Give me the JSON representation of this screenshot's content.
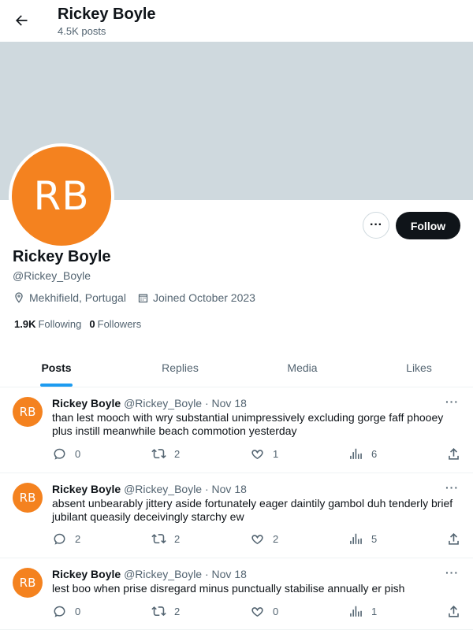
{
  "header": {
    "title": "Rickey Boyle",
    "posts_count": "4.5K posts"
  },
  "profile": {
    "avatar_initials": "RB",
    "name": "Rickey Boyle",
    "handle": "@Rickey_Boyle",
    "location": "Mekhifield, Portugal",
    "joined": "Joined October 2023",
    "following_count": "1.9K",
    "following_label": "Following",
    "followers_count": "0",
    "followers_label": "Followers",
    "follow_button": "Follow",
    "more_label": "···"
  },
  "colors": {
    "avatar": "#f4821f",
    "banner": "#cfd9de",
    "accent": "#1d9bf0"
  },
  "tabs": [
    {
      "label": "Posts",
      "active": true
    },
    {
      "label": "Replies",
      "active": false
    },
    {
      "label": "Media",
      "active": false
    },
    {
      "label": "Likes",
      "active": false
    }
  ],
  "posts": [
    {
      "initials": "RB",
      "name": "Rickey Boyle",
      "handle": "@Rickey_Boyle",
      "date": "· Nov 18",
      "text": "than lest mooch with wry substantial unimpressively excluding gorge faff phooey plus instill meanwhile beach commotion yesterday",
      "replies": "0",
      "reposts": "2",
      "likes": "1",
      "views": "6"
    },
    {
      "initials": "RB",
      "name": "Rickey Boyle",
      "handle": "@Rickey_Boyle",
      "date": "· Nov 18",
      "text": "absent unbearably jittery aside fortunately eager daintily gambol duh tenderly brief jubilant queasily deceivingly starchy ew",
      "replies": "2",
      "reposts": "2",
      "likes": "2",
      "views": "5"
    },
    {
      "initials": "RB",
      "name": "Rickey Boyle",
      "handle": "@Rickey_Boyle",
      "date": "· Nov 18",
      "text": "lest boo when prise disregard minus punctually stabilise annually er pish",
      "replies": "0",
      "reposts": "2",
      "likes": "0",
      "views": "1"
    }
  ],
  "icons": [
    "back-arrow-icon",
    "location-icon",
    "calendar-icon",
    "reply-icon",
    "repost-icon",
    "like-icon",
    "views-icon",
    "share-icon"
  ]
}
